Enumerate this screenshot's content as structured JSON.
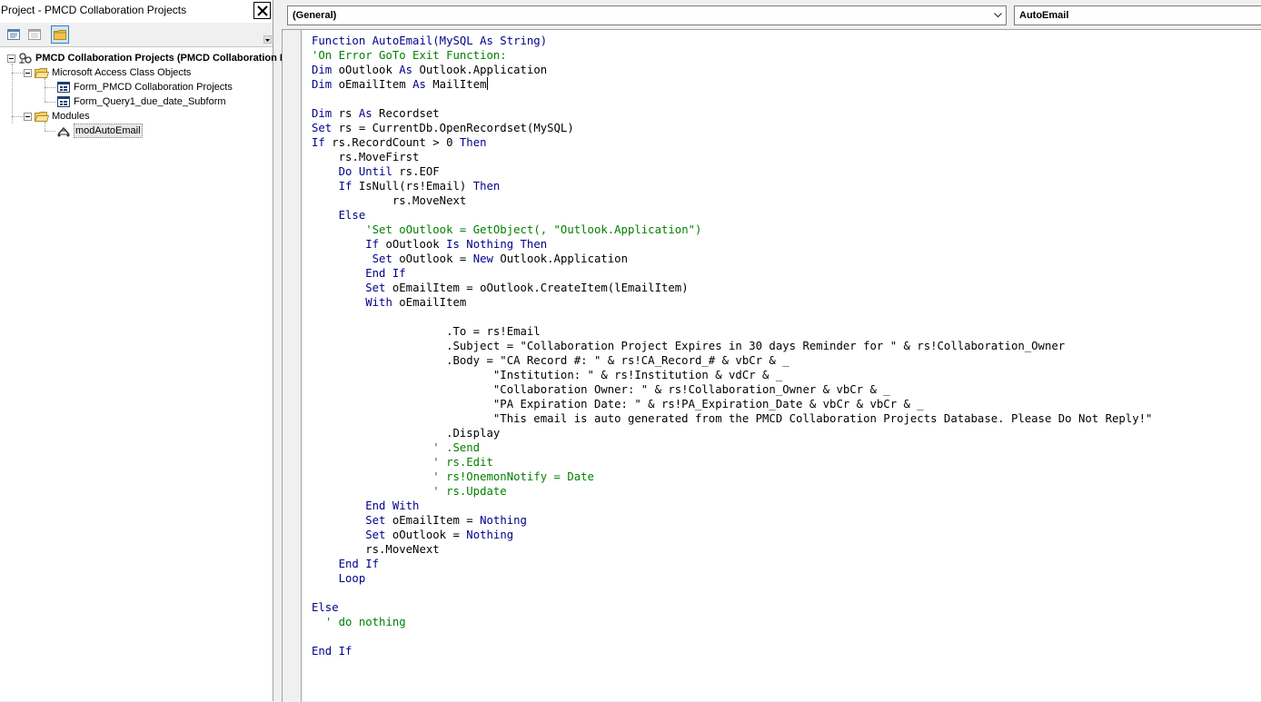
{
  "project": {
    "title": "Project - PMCD Collaboration Projects",
    "tree": {
      "root": "PMCD Collaboration Projects (PMCD Collaboration Projects)",
      "class_folder": "Microsoft Access Class Objects",
      "forms": [
        "Form_PMCD Collaboration Projects",
        "Form_Query1_due_date_Subform"
      ],
      "modules_folder": "Modules",
      "modules": [
        "modAutoEmail"
      ]
    }
  },
  "code_window": {
    "object_combo": "(General)",
    "procedure_combo": "AutoEmail",
    "lines": [
      [
        {
          "t": "Function AutoEmail(MySQL As String)",
          "c": "kw"
        }
      ],
      [
        {
          "t": "'On Error GoTo Exit Function:",
          "c": "cm"
        }
      ],
      [
        {
          "t": "Dim",
          "c": "kw"
        },
        {
          "t": " oOutlook "
        },
        {
          "t": "As",
          "c": "kw"
        },
        {
          "t": " Outlook.Application"
        }
      ],
      [
        {
          "t": "Dim",
          "c": "kw"
        },
        {
          "t": " oEmailItem "
        },
        {
          "t": "As",
          "c": "kw"
        },
        {
          "t": " MailItem"
        }
      ],
      [],
      [
        {
          "t": "Dim",
          "c": "kw"
        },
        {
          "t": " rs "
        },
        {
          "t": "As",
          "c": "kw"
        },
        {
          "t": " Recordset"
        }
      ],
      [
        {
          "t": "Set",
          "c": "kw"
        },
        {
          "t": " rs = CurrentDb.OpenRecordset(MySQL)"
        }
      ],
      [
        {
          "t": "If",
          "c": "kw"
        },
        {
          "t": " rs.RecordCount > 0 "
        },
        {
          "t": "Then",
          "c": "kw"
        }
      ],
      [
        {
          "t": "    rs.MoveFirst"
        }
      ],
      [
        {
          "t": "    "
        },
        {
          "t": "Do Until",
          "c": "kw"
        },
        {
          "t": " rs.EOF"
        }
      ],
      [
        {
          "t": "    "
        },
        {
          "t": "If",
          "c": "kw"
        },
        {
          "t": " IsNull(rs!Email) "
        },
        {
          "t": "Then",
          "c": "kw"
        }
      ],
      [
        {
          "t": "            rs.MoveNext"
        }
      ],
      [
        {
          "t": "    "
        },
        {
          "t": "Else",
          "c": "kw"
        }
      ],
      [
        {
          "t": "        "
        },
        {
          "t": "'Set oOutlook = GetObject(, \"Outlook.Application\")",
          "c": "cm"
        }
      ],
      [
        {
          "t": "        "
        },
        {
          "t": "If",
          "c": "kw"
        },
        {
          "t": " oOutlook "
        },
        {
          "t": "Is Nothing Then",
          "c": "kw"
        }
      ],
      [
        {
          "t": "         "
        },
        {
          "t": "Set",
          "c": "kw"
        },
        {
          "t": " oOutlook = "
        },
        {
          "t": "New",
          "c": "kw"
        },
        {
          "t": " Outlook.Application"
        }
      ],
      [
        {
          "t": "        "
        },
        {
          "t": "End If",
          "c": "kw"
        }
      ],
      [
        {
          "t": "        "
        },
        {
          "t": "Set",
          "c": "kw"
        },
        {
          "t": " oEmailItem = oOutlook.CreateItem(lEmailItem)"
        }
      ],
      [
        {
          "t": "        "
        },
        {
          "t": "With",
          "c": "kw"
        },
        {
          "t": " oEmailItem"
        }
      ],
      [],
      [
        {
          "t": "                    .To = rs!Email"
        }
      ],
      [
        {
          "t": "                    .Subject = \"Collaboration Project Expires in 30 days Reminder for \" & rs!Collaboration_Owner"
        }
      ],
      [
        {
          "t": "                    .Body = \"CA Record #: \" & rs!CA_Record_# & vbCr & _"
        }
      ],
      [
        {
          "t": "                           \"Institution: \" & rs!Institution & vdCr & _"
        }
      ],
      [
        {
          "t": "                           \"Collaboration Owner: \" & rs!Collaboration_Owner & vbCr & _"
        }
      ],
      [
        {
          "t": "                           \"PA Expiration Date: \" & rs!PA_Expiration_Date & vbCr & vbCr & _"
        }
      ],
      [
        {
          "t": "                           \"This email is auto generated from the PMCD Collaboration Projects Database. Please Do Not Reply!\""
        }
      ],
      [
        {
          "t": "                    .Display"
        }
      ],
      [
        {
          "t": "                  "
        },
        {
          "t": "' .Send",
          "c": "cm"
        }
      ],
      [
        {
          "t": "                  "
        },
        {
          "t": "' rs.Edit",
          "c": "cm"
        }
      ],
      [
        {
          "t": "                  "
        },
        {
          "t": "' rs!OnemonNotify = Date",
          "c": "cm"
        }
      ],
      [
        {
          "t": "                  "
        },
        {
          "t": "' rs.Update",
          "c": "cm"
        }
      ],
      [
        {
          "t": "        "
        },
        {
          "t": "End With",
          "c": "kw"
        }
      ],
      [
        {
          "t": "        "
        },
        {
          "t": "Set",
          "c": "kw"
        },
        {
          "t": " oEmailItem = "
        },
        {
          "t": "Nothing",
          "c": "kw"
        }
      ],
      [
        {
          "t": "        "
        },
        {
          "t": "Set",
          "c": "kw"
        },
        {
          "t": " oOutlook = "
        },
        {
          "t": "Nothing",
          "c": "kw"
        }
      ],
      [
        {
          "t": "        rs.MoveNext"
        }
      ],
      [
        {
          "t": "    "
        },
        {
          "t": "End If",
          "c": "kw"
        }
      ],
      [
        {
          "t": "    "
        },
        {
          "t": "Loop",
          "c": "kw"
        }
      ],
      [],
      [
        {
          "t": "Else",
          "c": "kw"
        }
      ],
      [
        {
          "t": "  "
        },
        {
          "t": "' do nothing",
          "c": "cm"
        }
      ],
      [],
      [
        {
          "t": "End If",
          "c": "kw"
        }
      ]
    ]
  }
}
